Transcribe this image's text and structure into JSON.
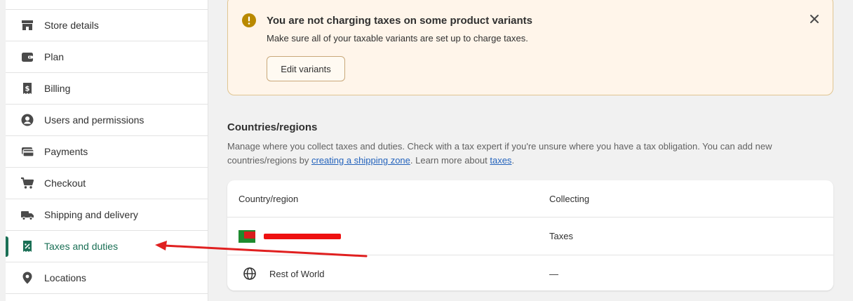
{
  "sidebar": {
    "items": [
      {
        "label": "Store details",
        "icon": "store-icon"
      },
      {
        "label": "Plan",
        "icon": "wallet-icon"
      },
      {
        "label": "Billing",
        "icon": "dollar-receipt-icon"
      },
      {
        "label": "Users and permissions",
        "icon": "user-circle-icon"
      },
      {
        "label": "Payments",
        "icon": "credit-card-icon"
      },
      {
        "label": "Checkout",
        "icon": "cart-icon"
      },
      {
        "label": "Shipping and delivery",
        "icon": "truck-icon"
      },
      {
        "label": "Taxes and duties",
        "icon": "tax-receipt-icon"
      },
      {
        "label": "Locations",
        "icon": "location-pin-icon"
      }
    ],
    "active": "Taxes and duties"
  },
  "banner": {
    "title": "You are not charging taxes on some product variants",
    "body": "Make sure all of your taxable variants are set up to charge taxes.",
    "button_label": "Edit variants"
  },
  "section": {
    "title": "Countries/regions",
    "desc_before": "Manage where you collect taxes and duties. Check with a tax expert if you're unsure where you have a tax obligation. You can add new countries/regions by ",
    "link1": "creating a shipping zone",
    "desc_middle": ". Learn more about ",
    "link2": "taxes",
    "desc_after": "."
  },
  "table": {
    "headers": [
      "Country/region",
      "Collecting"
    ],
    "rows": [
      {
        "country": "",
        "collecting": "Taxes"
      },
      {
        "country": "Rest of World",
        "collecting": "—"
      }
    ]
  },
  "colors": {
    "accent": "#1a6f55",
    "warning_bg": "#fff5ea",
    "warning_icon": "#b98900",
    "annotation": "#e02020"
  }
}
